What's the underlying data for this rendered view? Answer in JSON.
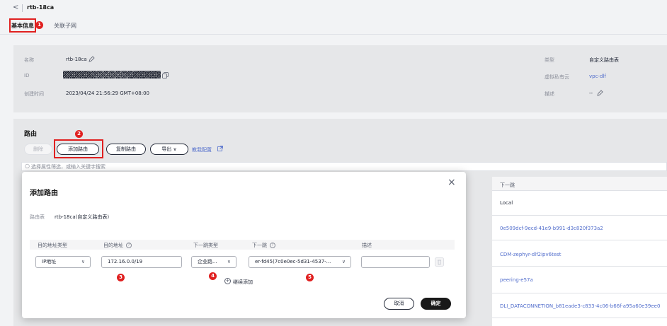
{
  "header": {
    "back_glyph": "<",
    "title": "rtb-18ca"
  },
  "tabs": [
    {
      "label": "基本信息"
    },
    {
      "label": "关联子网"
    }
  ],
  "info": {
    "name_label": "名称",
    "name_value": "rtb-18ca",
    "id_label": "ID",
    "created_label": "创建时间",
    "created_value": "2023/04/24 21:56:29 GMT+08:00",
    "type_label": "类型",
    "type_value": "自定义路由表",
    "vpc_label": "虚拟私有云",
    "vpc_value": "vpc-dlf",
    "desc_label": "描述",
    "desc_value": "--"
  },
  "routes": {
    "title": "路由",
    "delete_label": "删除",
    "add_label": "添加路由",
    "copy_label": "复制路由",
    "export_label": "导出",
    "learn_label": "教我配置",
    "search_placeholder": "选择属性筛选，或输入关键字搜索",
    "next_hop_header": "下一跳",
    "next_hops": [
      "Local",
      "0e509dcf-9ecd-41e9-b991-d3c820f373a2",
      "CDM-zephyr-dlf2ipv6test",
      "peering-e57a",
      "DLI_DATACONNETION_b81eade3-c833-4c06-b66f-a95a60e39ee0"
    ]
  },
  "modal": {
    "title": "添加路由",
    "close_glyph": "×",
    "route_table_label": "路由表",
    "route_table_value": "rtb-18ca(自定义路由表)",
    "col_dest_type": "目的地址类型",
    "col_dest": "目的地址",
    "col_next_hop_type": "下一跳类型",
    "col_next_hop": "下一跳",
    "col_desc": "描述",
    "dest_type_value": "IP地址",
    "dest_value": "172.16.0.0/19",
    "next_hop_type_value": "企业路...",
    "next_hop_value": "er-fd45(7c0e0ec-5d31-4537-...",
    "continue_add_label": "继续添加",
    "cancel_label": "取消",
    "confirm_label": "确定"
  },
  "badges": [
    "1",
    "2",
    "3",
    "4",
    "5"
  ],
  "colors": {
    "accent": "#526ecc",
    "annotation": "#e02020",
    "primary_button": "#191919"
  }
}
